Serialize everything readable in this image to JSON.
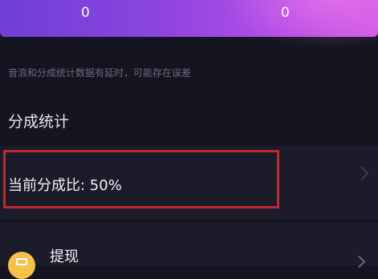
{
  "stats": {
    "left_value": "0",
    "right_value": "0"
  },
  "notice": "音浪和分成统计数据有延时，可能存在误差",
  "section": {
    "title": "分成统计"
  },
  "ratio": {
    "text": "当前分成比: 50%"
  },
  "withdraw": {
    "label": "提现"
  }
}
